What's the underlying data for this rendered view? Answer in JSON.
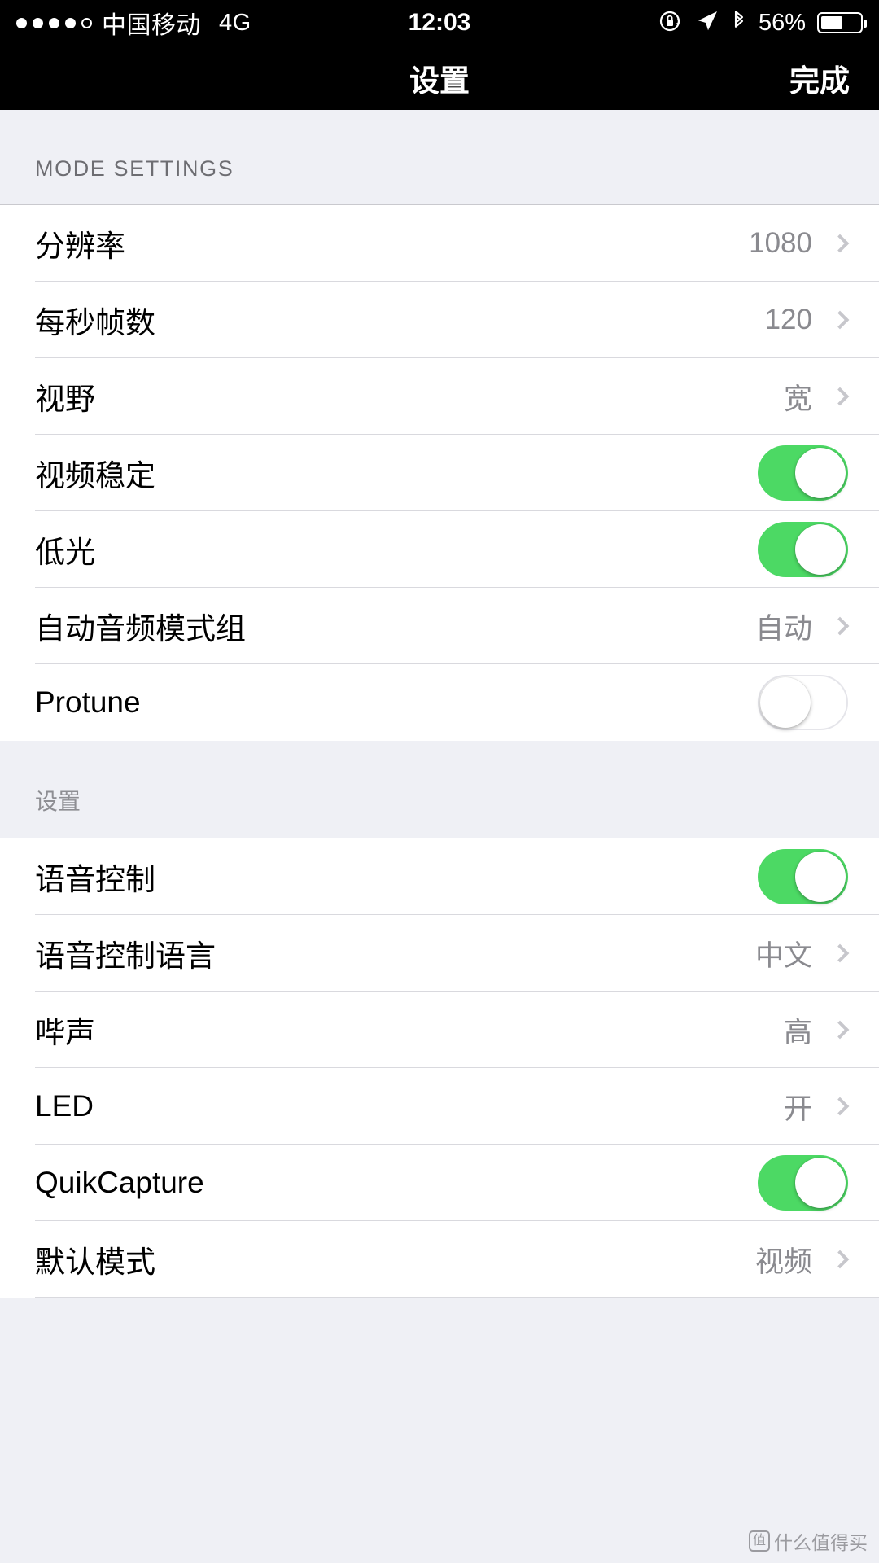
{
  "statusbar": {
    "signal_dots_filled": 4,
    "signal_dots_total": 5,
    "carrier": "中国移动",
    "network": "4G",
    "time": "12:03",
    "battery_percent": "56%",
    "battery_level": 56,
    "icons": [
      "rotation-lock-icon",
      "location-arrow-icon",
      "bluetooth-icon"
    ]
  },
  "navbar": {
    "title": "设置",
    "done_label": "完成"
  },
  "sections": [
    {
      "header": "MODE SETTINGS",
      "header_style": "upper",
      "rows": [
        {
          "label": "分辨率",
          "type": "disclosure",
          "value": "1080"
        },
        {
          "label": "每秒帧数",
          "type": "disclosure",
          "value": "120"
        },
        {
          "label": "视野",
          "type": "disclosure",
          "value": "宽"
        },
        {
          "label": "视频稳定",
          "type": "toggle",
          "state": "on"
        },
        {
          "label": "低光",
          "type": "toggle",
          "state": "on"
        },
        {
          "label": "自动音频模式组",
          "type": "disclosure",
          "value": "自动"
        },
        {
          "label": "Protune",
          "type": "toggle",
          "state": "off"
        }
      ]
    },
    {
      "header": "设置",
      "header_style": "cn",
      "rows": [
        {
          "label": "语音控制",
          "type": "toggle",
          "state": "on"
        },
        {
          "label": "语音控制语言",
          "type": "disclosure",
          "value": "中文"
        },
        {
          "label": "哔声",
          "type": "disclosure",
          "value": "高"
        },
        {
          "label": "LED",
          "type": "disclosure",
          "value": "开"
        },
        {
          "label": "QuikCapture",
          "type": "toggle",
          "state": "on"
        },
        {
          "label": "默认模式",
          "type": "disclosure",
          "value": "视频"
        }
      ]
    }
  ],
  "watermark": {
    "text": "什么值得买",
    "icon": "smzdm-logo-icon",
    "glyph": "值"
  },
  "colors": {
    "toggle_on": "#4cd964",
    "group_bg": "#ffffff",
    "page_bg": "#eff0f5",
    "bar_bg": "#000000",
    "value_text": "#8a8a8f",
    "chevron": "#c7c7cc"
  }
}
